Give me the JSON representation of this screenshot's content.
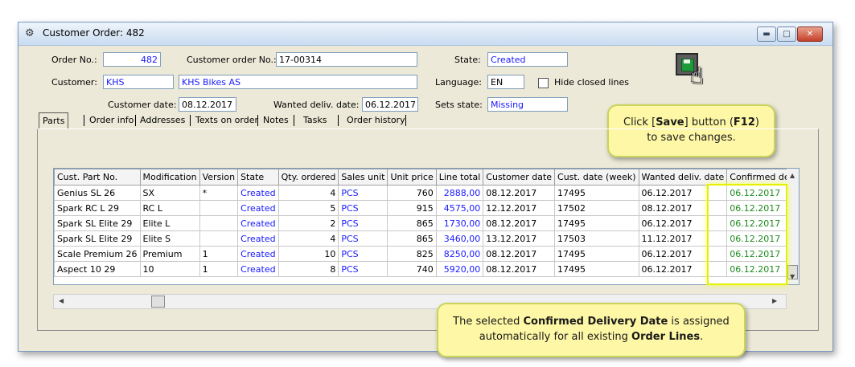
{
  "window": {
    "title": "Customer Order: 482"
  },
  "header": {
    "order_no_label": "Order No.:",
    "order_no": "482",
    "customer_order_no_label": "Customer order No.:",
    "customer_order_no": "17-00314",
    "state_label": "State:",
    "state": "Created",
    "customer_label": "Customer:",
    "customer_code": "KHS",
    "customer_name": "KHS Bikes AS",
    "language_label": "Language:",
    "language": "EN",
    "hide_closed_lines_label": "Hide closed lines",
    "customer_date_label": "Customer date:",
    "customer_date": "08.12.2017",
    "wanted_deliv_date_label": "Wanted deliv. date:",
    "wanted_deliv_date": "06.12.2017",
    "sets_state_label": "Sets state:",
    "sets_state": "Missing"
  },
  "tabs": [
    "Parts",
    "Order info",
    "Addresses",
    "Texts on order",
    "Notes",
    "Tasks",
    "Order history"
  ],
  "grid": {
    "columns": [
      "Cust. Part No.",
      "Modification",
      "Version",
      "State",
      "Qty. ordered",
      "Sales unit",
      "Unit price",
      "Line total",
      "Customer date",
      "Cust. date (week)",
      "Wanted deliv. date",
      "Confirmed deliv. date"
    ],
    "rows": [
      [
        "Genius SL 26",
        "SX",
        "*",
        "Created",
        "4",
        "PCS",
        "760",
        "2888,00",
        "08.12.2017",
        "17495",
        "06.12.2017",
        "06.12.2017"
      ],
      [
        "Spark RC L 29",
        "RC L",
        "",
        "Created",
        "5",
        "PCS",
        "915",
        "4575,00",
        "12.12.2017",
        "17502",
        "08.12.2017",
        "06.12.2017"
      ],
      [
        "Spark SL Elite 29",
        "Elite L",
        "",
        "Created",
        "2",
        "PCS",
        "865",
        "1730,00",
        "08.12.2017",
        "17495",
        "06.12.2017",
        "06.12.2017"
      ],
      [
        "Spark SL Elite 29",
        "Elite S",
        "",
        "Created",
        "4",
        "PCS",
        "865",
        "3460,00",
        "13.12.2017",
        "17503",
        "11.12.2017",
        "06.12.2017"
      ],
      [
        "Scale Premium 26",
        "Premium",
        "1",
        "Created",
        "10",
        "PCS",
        "825",
        "8250,00",
        "08.12.2017",
        "17495",
        "06.12.2017",
        "06.12.2017"
      ],
      [
        "Aspect 10 29",
        "10",
        "1",
        "Created",
        "8",
        "PCS",
        "740",
        "5920,00",
        "08.12.2017",
        "17495",
        "06.12.2017",
        "06.12.2017"
      ]
    ]
  },
  "callouts": {
    "save_prefix": "Click [",
    "save_bold": "Save",
    "save_mid": "] button (",
    "save_key": "F12",
    "save_suffix": ")",
    "save_line2": "to save changes.",
    "conf_prefix": "The selected ",
    "conf_bold": "Confirmed Delivery Date",
    "conf_suffix": " is assigned",
    "conf_line2_prefix": "automatically for all existing ",
    "conf_line2_bold": "Order Lines",
    "conf_line2_suffix": "."
  },
  "icons": {
    "app": "app-icon",
    "save": "save-disk-icon",
    "cursor": "hand-cursor-icon"
  },
  "colors": {
    "link_blue": "#1a1aff",
    "confirmed_green": "#1c8a1c",
    "callout_bg": "#fdf7a6",
    "highlight": "#e6f000"
  }
}
